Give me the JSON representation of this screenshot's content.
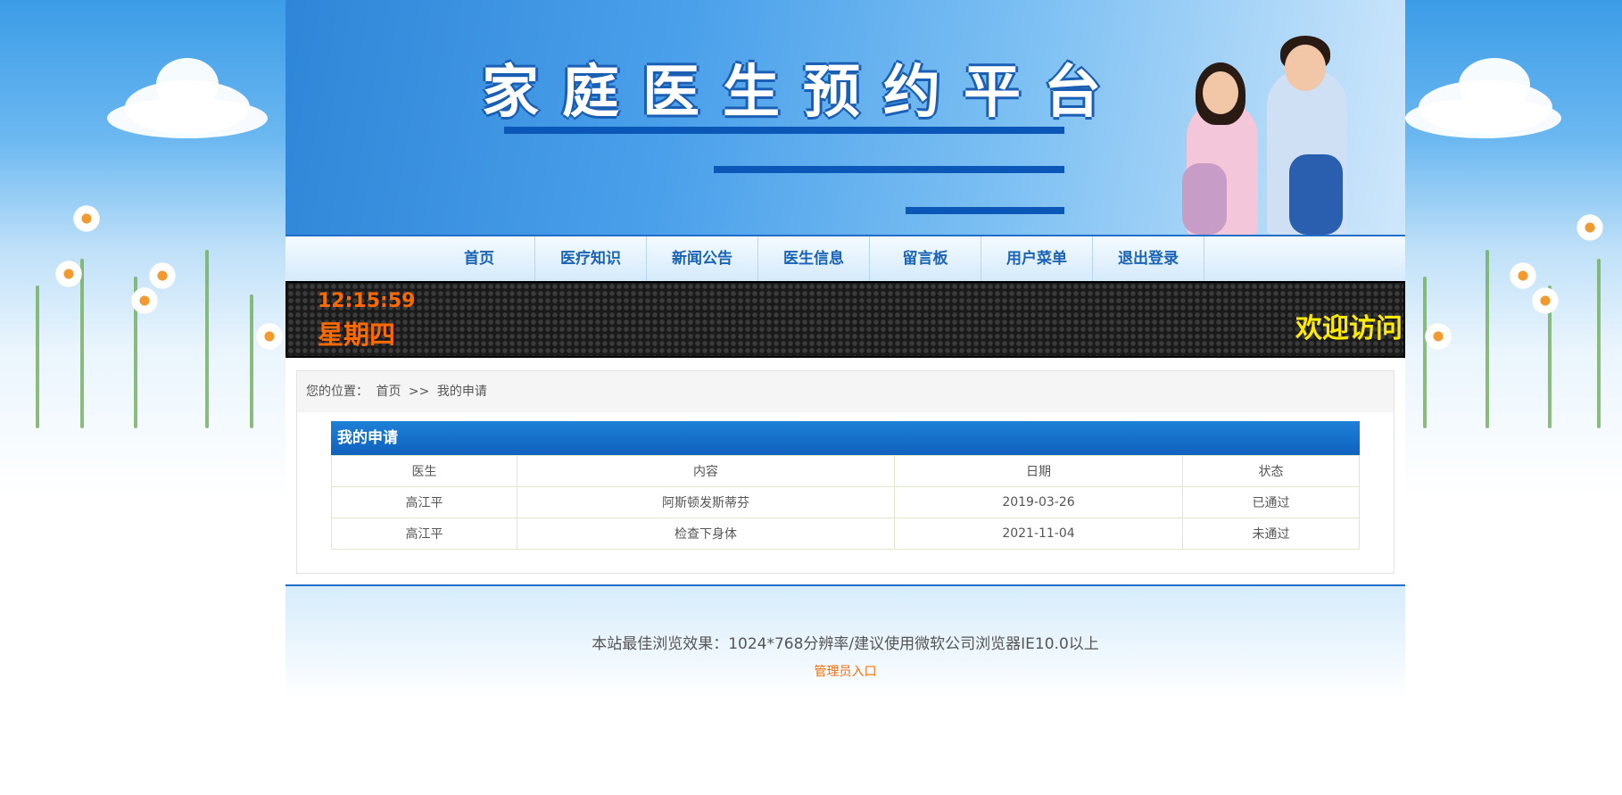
{
  "header": {
    "title": "家庭医生预约平台"
  },
  "nav": {
    "items": [
      {
        "label": "首页"
      },
      {
        "label": "医疗知识"
      },
      {
        "label": "新闻公告"
      },
      {
        "label": "医生信息"
      },
      {
        "label": "留言板"
      },
      {
        "label": "用户菜单"
      },
      {
        "label": "退出登录"
      }
    ]
  },
  "ticker": {
    "time": "12:15:59",
    "weekday": "星期四",
    "marquee": "欢迎访问"
  },
  "breadcrumb": {
    "prefix": "您的位置：",
    "home": "首页",
    "separator": ">>",
    "current": "我的申请"
  },
  "panel": {
    "title": "我的申请",
    "columns": [
      "医生",
      "内容",
      "日期",
      "状态"
    ],
    "rows": [
      [
        "高江平",
        "阿斯顿发斯蒂芬",
        "2019-03-26",
        "已通过"
      ],
      [
        "高江平",
        "检查下身体",
        "2021-11-04",
        "未通过"
      ]
    ]
  },
  "footer": {
    "note": "本站最佳浏览效果：1024*768分辨率/建议使用微软公司浏览器IE10.0以上",
    "admin_link": "管理员入口"
  },
  "colors": {
    "nav_text": "#1a63b5",
    "accent_orange": "#ff6a00",
    "marquee": "#ffeb00",
    "panel_blue": "#0f62bf"
  }
}
